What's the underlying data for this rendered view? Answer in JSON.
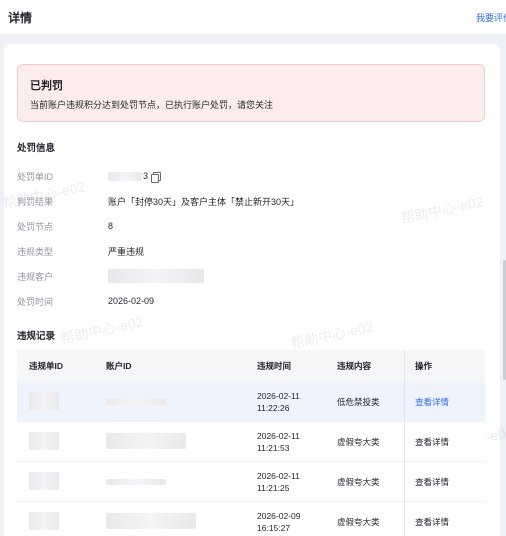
{
  "header": {
    "title": "详情",
    "link": "我要评价"
  },
  "alert": {
    "title": "已判罚",
    "desc": "当前账户违规积分达到处罚节点，已执行账户处罚，请您关注"
  },
  "penalty": {
    "section_title": "处罚信息",
    "fields": [
      {
        "label": "处罚单ID",
        "value": "3"
      },
      {
        "label": "判罚结果",
        "value": "账户「封停30天」及客户主体「禁止新开30天」"
      },
      {
        "label": "处罚节点",
        "value": "8"
      },
      {
        "label": "违规类型",
        "value": "严重违规"
      },
      {
        "label": "违规客户",
        "value": ""
      },
      {
        "label": "处罚时间",
        "value": "2026-02-09"
      }
    ]
  },
  "records": {
    "section_title": "违规记录",
    "columns": [
      "违规单ID",
      "账户ID",
      "违规时间",
      "违规内容",
      "操作"
    ],
    "rows": [
      {
        "date": "2026-02-11",
        "time": "11:22:26",
        "content": "低危禁投类",
        "action": "查看详情"
      },
      {
        "date": "2026-02-11",
        "time": "11:21:53",
        "content": "虚假夸大类",
        "action": "查看详情"
      },
      {
        "date": "2026-02-11",
        "time": "11:21:25",
        "content": "虚假夸大类",
        "action": "查看详情"
      },
      {
        "date": "2026-02-09",
        "time": "16:15:27",
        "content": "虚假夸大类",
        "action": "查看详情"
      }
    ]
  },
  "watermark": "帮助中心-e02",
  "colors": {
    "accent": "#2f6ef7",
    "alert_bg": "#fdecec",
    "alert_border": "#f6c9c9"
  }
}
